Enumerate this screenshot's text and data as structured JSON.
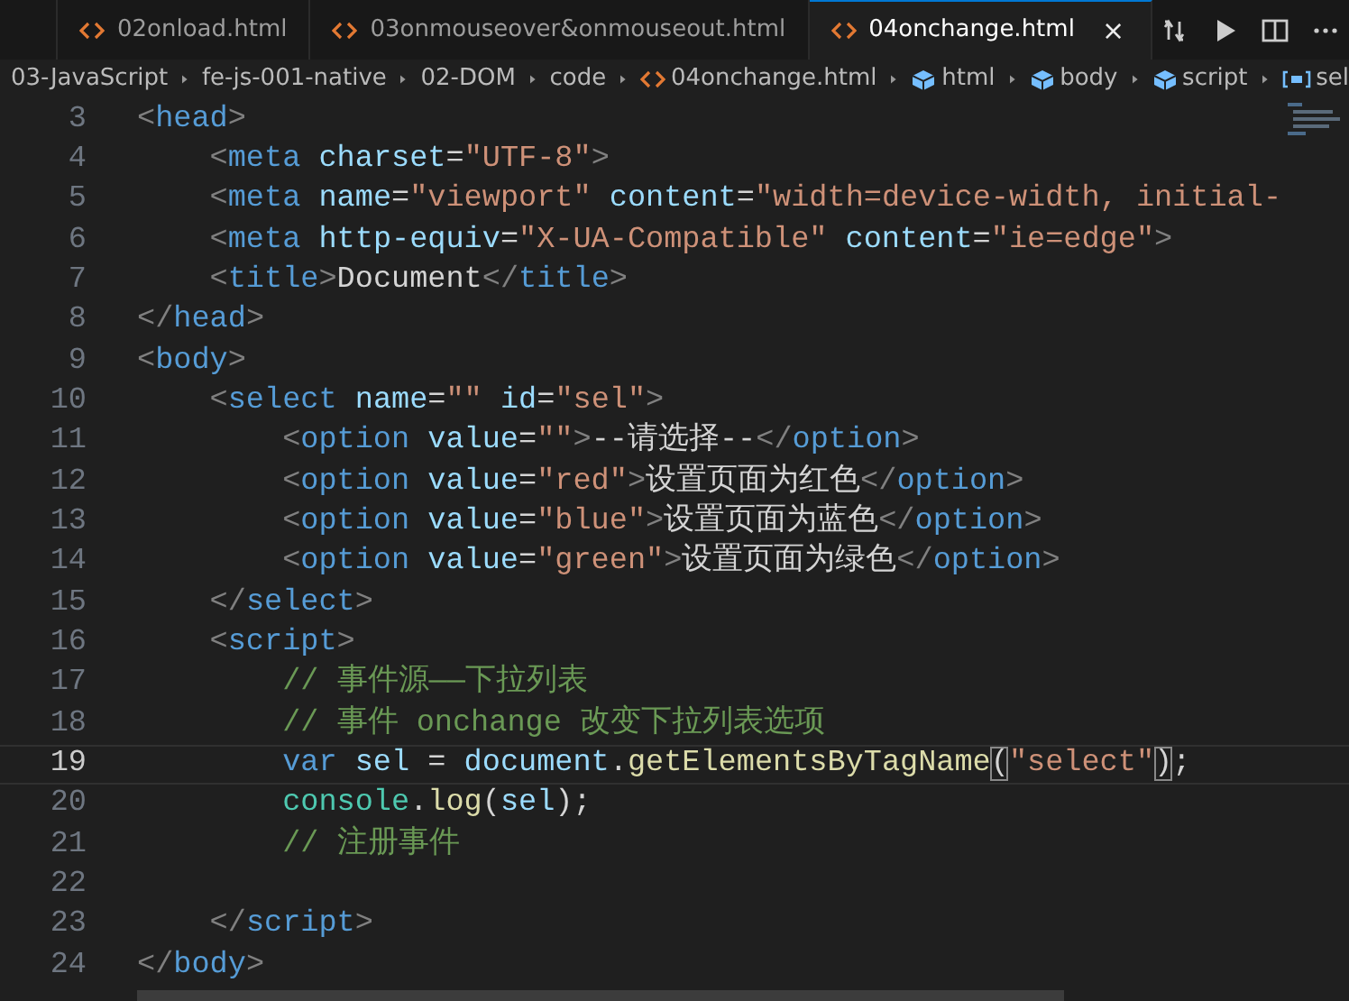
{
  "tabs": [
    {
      "selected": false,
      "cut": true
    },
    {
      "label": "02onload.html",
      "selected": false
    },
    {
      "label": "03onmouseover&onmouseout.html",
      "selected": false
    },
    {
      "label": "04onchange.html",
      "selected": true,
      "close": "×"
    }
  ],
  "toolbar": [
    {
      "kind": "compare"
    },
    {
      "kind": "run"
    },
    {
      "kind": "split"
    },
    {
      "kind": "more"
    }
  ],
  "breadcrumbs": [
    {
      "kind": "folder",
      "label": "03-JavaScript"
    },
    {
      "kind": "folder",
      "label": "fe-js-001-native"
    },
    {
      "kind": "folder",
      "label": "02-DOM"
    },
    {
      "kind": "folder",
      "label": "code"
    },
    {
      "kind": "file",
      "label": "04onchange.html"
    },
    {
      "kind": "element",
      "label": "html"
    },
    {
      "kind": "element",
      "label": "body"
    },
    {
      "kind": "element",
      "label": "script"
    },
    {
      "kind": "variable",
      "label": "sel"
    }
  ],
  "lines": [
    {
      "number": "3",
      "current": false,
      "tokens": [
        {
          "kind": "punct",
          "text": "<"
        },
        {
          "kind": "tag",
          "text": "head"
        },
        {
          "kind": "punct",
          "text": ">"
        }
      ]
    },
    {
      "number": "4",
      "current": false,
      "tokens": [
        {
          "kind": "punct",
          "text": "    <"
        },
        {
          "kind": "tag",
          "text": "meta"
        },
        {
          "kind": "attr",
          "text": " charset"
        },
        {
          "kind": "plain",
          "text": "="
        },
        {
          "kind": "string",
          "text": "\"UTF-8\""
        },
        {
          "kind": "punct",
          "text": ">"
        }
      ]
    },
    {
      "number": "5",
      "current": false,
      "tokens": [
        {
          "kind": "punct",
          "text": "    <"
        },
        {
          "kind": "tag",
          "text": "meta"
        },
        {
          "kind": "attr",
          "text": " name"
        },
        {
          "kind": "plain",
          "text": "="
        },
        {
          "kind": "string",
          "text": "\"viewport\""
        },
        {
          "kind": "attr",
          "text": " content"
        },
        {
          "kind": "plain",
          "text": "="
        },
        {
          "kind": "string",
          "text": "\"width=device-width, initial-"
        }
      ]
    },
    {
      "number": "6",
      "current": false,
      "tokens": [
        {
          "kind": "punct",
          "text": "    <"
        },
        {
          "kind": "tag",
          "text": "meta"
        },
        {
          "kind": "attr",
          "text": " http-equiv"
        },
        {
          "kind": "plain",
          "text": "="
        },
        {
          "kind": "string",
          "text": "\"X-UA-Compatible\""
        },
        {
          "kind": "attr",
          "text": " content"
        },
        {
          "kind": "plain",
          "text": "="
        },
        {
          "kind": "string",
          "text": "\"ie=edge\""
        },
        {
          "kind": "punct",
          "text": ">"
        }
      ]
    },
    {
      "number": "7",
      "current": false,
      "tokens": [
        {
          "kind": "punct",
          "text": "    <"
        },
        {
          "kind": "tag",
          "text": "title"
        },
        {
          "kind": "punct",
          "text": ">"
        },
        {
          "kind": "plain",
          "text": "Document"
        },
        {
          "kind": "punct",
          "text": "</"
        },
        {
          "kind": "tag",
          "text": "title"
        },
        {
          "kind": "punct",
          "text": ">"
        }
      ]
    },
    {
      "number": "8",
      "current": false,
      "tokens": [
        {
          "kind": "punct",
          "text": "</"
        },
        {
          "kind": "tag",
          "text": "head"
        },
        {
          "kind": "punct",
          "text": ">"
        }
      ]
    },
    {
      "number": "9",
      "current": false,
      "tokens": [
        {
          "kind": "punct",
          "text": "<"
        },
        {
          "kind": "tag",
          "text": "body"
        },
        {
          "kind": "punct",
          "text": ">"
        }
      ]
    },
    {
      "number": "10",
      "current": false,
      "tokens": [
        {
          "kind": "punct",
          "text": "    <"
        },
        {
          "kind": "tag",
          "text": "select"
        },
        {
          "kind": "attr",
          "text": " name"
        },
        {
          "kind": "plain",
          "text": "="
        },
        {
          "kind": "string",
          "text": "\"\""
        },
        {
          "kind": "attr",
          "text": " id"
        },
        {
          "kind": "plain",
          "text": "="
        },
        {
          "kind": "string",
          "text": "\"sel\""
        },
        {
          "kind": "punct",
          "text": ">"
        }
      ]
    },
    {
      "number": "11",
      "current": false,
      "tokens": [
        {
          "kind": "punct",
          "text": "        <"
        },
        {
          "kind": "tag",
          "text": "option"
        },
        {
          "kind": "attr",
          "text": " value"
        },
        {
          "kind": "plain",
          "text": "="
        },
        {
          "kind": "string",
          "text": "\"\""
        },
        {
          "kind": "punct",
          "text": ">"
        },
        {
          "kind": "plain",
          "text": "--请选择--"
        },
        {
          "kind": "punct",
          "text": "</"
        },
        {
          "kind": "tag",
          "text": "option"
        },
        {
          "kind": "punct",
          "text": ">"
        }
      ]
    },
    {
      "number": "12",
      "current": false,
      "tokens": [
        {
          "kind": "punct",
          "text": "        <"
        },
        {
          "kind": "tag",
          "text": "option"
        },
        {
          "kind": "attr",
          "text": " value"
        },
        {
          "kind": "plain",
          "text": "="
        },
        {
          "kind": "string",
          "text": "\"red\""
        },
        {
          "kind": "punct",
          "text": ">"
        },
        {
          "kind": "plain",
          "text": "设置页面为红色"
        },
        {
          "kind": "punct",
          "text": "</"
        },
        {
          "kind": "tag",
          "text": "option"
        },
        {
          "kind": "punct",
          "text": ">"
        }
      ]
    },
    {
      "number": "13",
      "current": false,
      "tokens": [
        {
          "kind": "punct",
          "text": "        <"
        },
        {
          "kind": "tag",
          "text": "option"
        },
        {
          "kind": "attr",
          "text": " value"
        },
        {
          "kind": "plain",
          "text": "="
        },
        {
          "kind": "string",
          "text": "\"blue\""
        },
        {
          "kind": "punct",
          "text": ">"
        },
        {
          "kind": "plain",
          "text": "设置页面为蓝色"
        },
        {
          "kind": "punct",
          "text": "</"
        },
        {
          "kind": "tag",
          "text": "option"
        },
        {
          "kind": "punct",
          "text": ">"
        }
      ]
    },
    {
      "number": "14",
      "current": false,
      "tokens": [
        {
          "kind": "punct",
          "text": "        <"
        },
        {
          "kind": "tag",
          "text": "option"
        },
        {
          "kind": "attr",
          "text": " value"
        },
        {
          "kind": "plain",
          "text": "="
        },
        {
          "kind": "string",
          "text": "\"green\""
        },
        {
          "kind": "punct",
          "text": ">"
        },
        {
          "kind": "plain",
          "text": "设置页面为绿色"
        },
        {
          "kind": "punct",
          "text": "</"
        },
        {
          "kind": "tag",
          "text": "option"
        },
        {
          "kind": "punct",
          "text": ">"
        }
      ]
    },
    {
      "number": "15",
      "current": false,
      "tokens": [
        {
          "kind": "punct",
          "text": "    </"
        },
        {
          "kind": "tag",
          "text": "select"
        },
        {
          "kind": "punct",
          "text": ">"
        }
      ]
    },
    {
      "number": "16",
      "current": false,
      "tokens": [
        {
          "kind": "punct",
          "text": "    <"
        },
        {
          "kind": "tag",
          "text": "script"
        },
        {
          "kind": "punct",
          "text": ">"
        }
      ]
    },
    {
      "number": "17",
      "current": false,
      "tokens": [
        {
          "kind": "comment",
          "text": "        // 事件源——下拉列表"
        }
      ]
    },
    {
      "number": "18",
      "current": false,
      "tokens": [
        {
          "kind": "comment",
          "text": "        // 事件 onchange 改变下拉列表选项"
        }
      ]
    },
    {
      "number": "19",
      "current": true,
      "tokens": [
        {
          "kind": "keyword",
          "text": "        var"
        },
        {
          "kind": "variable",
          "text": " sel"
        },
        {
          "kind": "plain",
          "text": " = "
        },
        {
          "kind": "variable",
          "text": "document"
        },
        {
          "kind": "plain",
          "text": "."
        },
        {
          "kind": "function",
          "text": "getElementsByTagName"
        },
        {
          "kind": "bracket",
          "text": "("
        },
        {
          "kind": "string",
          "text": "\"select\""
        },
        {
          "kind": "bracket",
          "text": ")"
        },
        {
          "kind": "plain",
          "text": ";"
        }
      ]
    },
    {
      "number": "20",
      "current": false,
      "tokens": [
        {
          "kind": "class",
          "text": "        console"
        },
        {
          "kind": "plain",
          "text": "."
        },
        {
          "kind": "function",
          "text": "log"
        },
        {
          "kind": "plain",
          "text": "("
        },
        {
          "kind": "variable",
          "text": "sel"
        },
        {
          "kind": "plain",
          "text": ");"
        }
      ]
    },
    {
      "number": "21",
      "current": false,
      "tokens": [
        {
          "kind": "comment",
          "text": "        // 注册事件"
        }
      ]
    },
    {
      "number": "22",
      "current": false
    },
    {
      "number": "23",
      "current": false,
      "tokens": [
        {
          "kind": "punct",
          "text": "    </"
        },
        {
          "kind": "tag",
          "text": "script"
        },
        {
          "kind": "punct",
          "text": ">"
        }
      ]
    },
    {
      "number": "24",
      "current": false,
      "tokens": [
        {
          "kind": "punct",
          "text": "</"
        },
        {
          "kind": "tag",
          "text": "body"
        },
        {
          "kind": "punct",
          "text": ">"
        }
      ]
    }
  ]
}
